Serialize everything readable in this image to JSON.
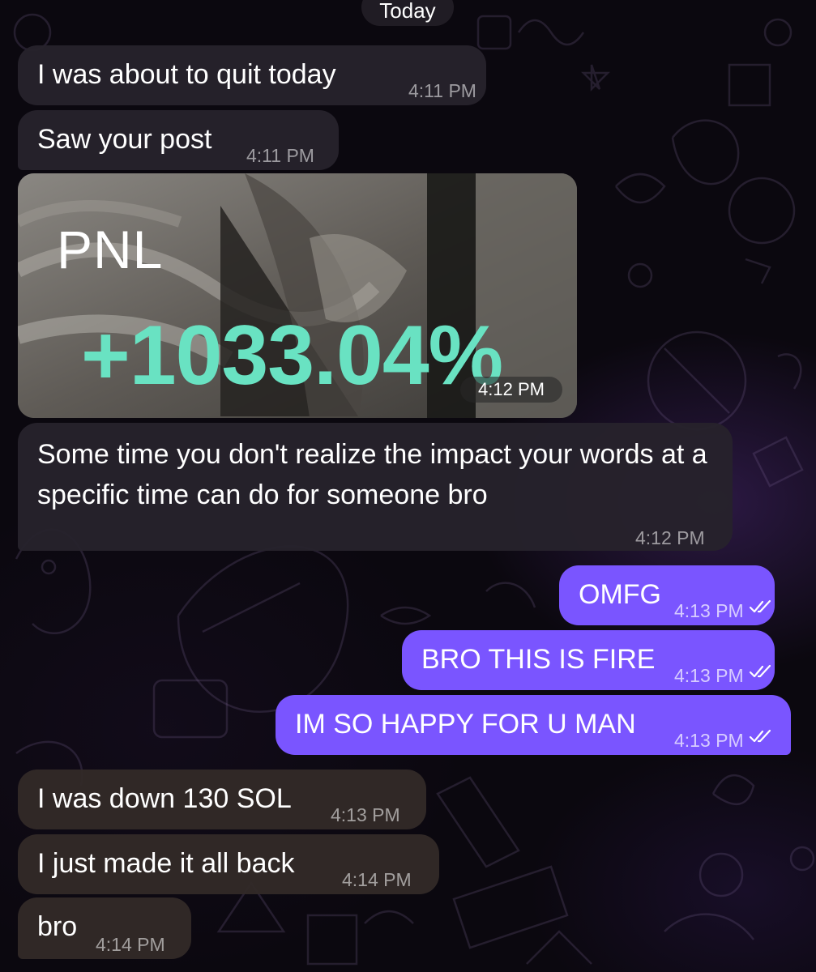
{
  "date_divider": "Today",
  "photo": {
    "pnl_label": "PNL",
    "pnl_value": "+1033.04%",
    "time": "4:12 PM"
  },
  "messages": [
    {
      "text": "I was about to quit today",
      "time": "4:11 PM",
      "direction": "incoming"
    },
    {
      "text": "Saw your post",
      "time": "4:11 PM",
      "direction": "incoming"
    },
    {
      "text": "Some time you don't realize the impact your words at a specific time can do for someone bro",
      "time": "4:12 PM",
      "direction": "incoming"
    },
    {
      "text": "OMFG",
      "time": "4:13 PM",
      "direction": "outgoing",
      "status": "read"
    },
    {
      "text": "BRO THIS IS FIRE",
      "time": "4:13 PM",
      "direction": "outgoing",
      "status": "read"
    },
    {
      "text": "IM SO HAPPY FOR U MAN",
      "time": "4:13 PM",
      "direction": "outgoing",
      "status": "read"
    },
    {
      "text": "I was down 130 SOL",
      "time": "4:13 PM",
      "direction": "incoming"
    },
    {
      "text": "I just made it all back",
      "time": "4:14 PM",
      "direction": "incoming"
    },
    {
      "text": "bro",
      "time": "4:14 PM",
      "direction": "incoming"
    }
  ],
  "icons": {
    "read_receipt": "double-check-icon"
  },
  "colors": {
    "outgoing_bubble": "#7a55ff",
    "incoming_bubble": "#26222c",
    "pnl_accent": "#69e2c2",
    "background": "#0b080f"
  }
}
